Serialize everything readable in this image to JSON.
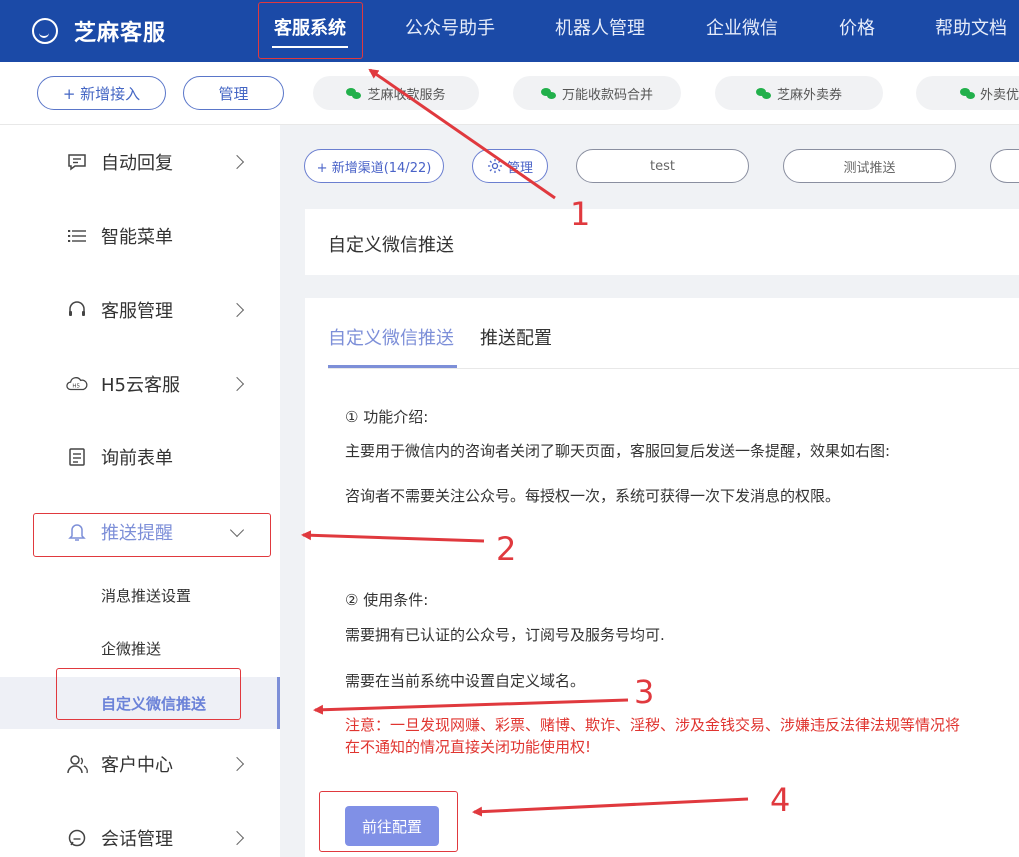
{
  "app": {
    "name": "芝麻客服"
  },
  "topnav": [
    "客服系统",
    "公众号助手",
    "机器人管理",
    "企业微信",
    "价格",
    "帮助文档"
  ],
  "subbar": {
    "add_label": "+ 新增接入",
    "manage_label": "管理",
    "mini_apps": [
      "芝麻收款服务",
      "万能收款码合并",
      "芝麻外卖券",
      "外卖优"
    ]
  },
  "sidebar": {
    "items": [
      {
        "label": "自动回复",
        "icon": "chat-icon"
      },
      {
        "label": "智能菜单",
        "icon": "list-icon"
      },
      {
        "label": "客服管理",
        "icon": "headset-icon"
      },
      {
        "label": "H5云客服",
        "icon": "cloud-icon"
      },
      {
        "label": "询前表单",
        "icon": "form-icon"
      },
      {
        "label": "推送提醒",
        "icon": "bell-icon"
      },
      {
        "label": "客户中心",
        "icon": "user-icon"
      },
      {
        "label": "会话管理",
        "icon": "message-icon"
      }
    ],
    "sub_items": [
      "消息推送设置",
      "企微推送",
      "自定义微信推送"
    ]
  },
  "toolbar": {
    "add_channel": "+ 新增渠道(14/22)",
    "manage": "管理",
    "channels": [
      "test",
      "测试推送"
    ]
  },
  "page": {
    "title": "自定义微信推送",
    "tabs": [
      "自定义微信推送",
      "推送配置"
    ],
    "intro_heading": "① 功能介绍:",
    "intro_line1": "主要用于微信内的咨询者关闭了聊天页面，客服回复后发送一条提醒，效果如右图:",
    "intro_line2": "咨询者不需要关注公众号。每授权一次，系统可获得一次下发消息的权限。",
    "cond_heading": "② 使用条件:",
    "cond_line1": "需要拥有已认证的公众号，订阅号及服务号均可.",
    "cond_line2": "需要在当前系统中设置自定义域名。",
    "warning": "注意：一旦发现网赚、彩票、赌博、欺诈、淫秽、涉及金钱交易、涉嫌违反法律法规等情况将在不通知的情况直接关闭功能使用权!",
    "go_button": "前往配置"
  },
  "annotations": [
    "1",
    "2",
    "3",
    "4"
  ],
  "colors": {
    "topbar": "#1b4aa7",
    "accent": "#7d8fd8",
    "annotation": "#e0393e",
    "warning": "#e03530"
  }
}
